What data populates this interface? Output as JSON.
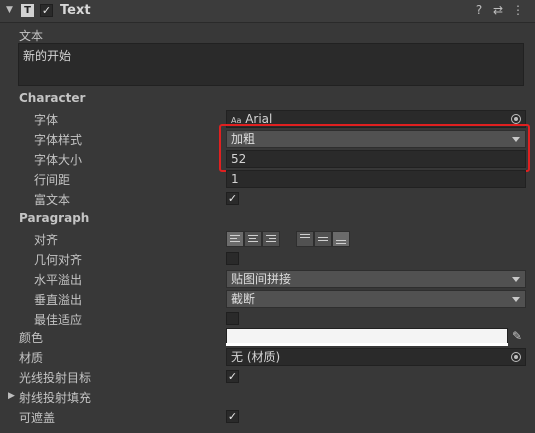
{
  "header": {
    "fold_icon": "triangle-down-icon",
    "type_icon": "T",
    "enabled_check": "✓",
    "title": "Text",
    "help_icon": "?",
    "preset_icon": "⇄",
    "menu_icon": "⋮"
  },
  "text_field": {
    "label": "文本",
    "value": "新的开始"
  },
  "character": {
    "heading": "Character",
    "font_label": "字体",
    "font_prefix": "Aa",
    "font_value": "Arial",
    "style_label": "字体样式",
    "style_value": "加粗",
    "size_label": "字体大小",
    "size_value": "52",
    "line_spacing_label": "行间距",
    "line_spacing_value": "1",
    "rich_text_label": "富文本",
    "rich_text_check": "✓"
  },
  "paragraph": {
    "heading": "Paragraph",
    "alignment_label": "对齐",
    "geometry_label": "几何对齐",
    "horizontal_overflow_label": "水平溢出",
    "horizontal_overflow_value": "贴图间拼接",
    "vertical_overflow_label": "垂直溢出",
    "vertical_overflow_value": "截断",
    "best_fit_label": "最佳适应"
  },
  "misc": {
    "color_label": "颜色",
    "color_value": "#f4f4f4",
    "material_label": "材质",
    "material_value": "无 (材质)",
    "raycast_label": "光线投射目标",
    "raycast_check": "✓",
    "raycast_padding_label": "射线投射填充",
    "maskable_label": "可遮盖",
    "maskable_check": "✓"
  },
  "colors": {
    "highlight": "#e02020",
    "panel": "#383838"
  }
}
